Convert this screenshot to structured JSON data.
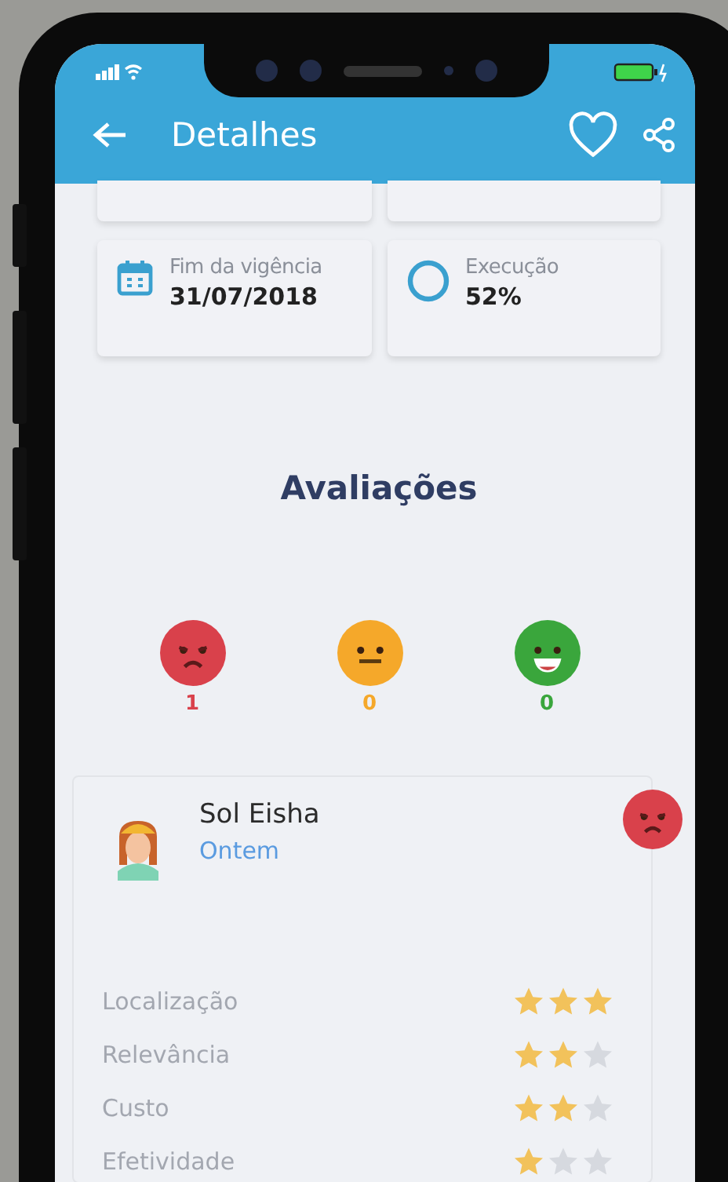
{
  "header": {
    "title": "Detalhes",
    "favorite": false
  },
  "info_cards": [
    {
      "kind": "calendar",
      "label": "Fim da vigência",
      "value": "31/07/2018"
    },
    {
      "kind": "progress",
      "label": "Execução",
      "value": "52%"
    }
  ],
  "section_title": "Avaliações",
  "sentiment_counts": [
    {
      "kind": "negative",
      "count": "1",
      "color": "#d9414b"
    },
    {
      "kind": "neutral",
      "count": "0",
      "color": "#f5a82a"
    },
    {
      "kind": "positive",
      "count": "0",
      "color": "#3aa63c"
    }
  ],
  "review": {
    "author": "Sol Eisha",
    "time": "Ontem",
    "kind": "negative",
    "criteria": [
      {
        "label": "Localização",
        "stars": 3
      },
      {
        "label": "Relevância",
        "stars": 2
      },
      {
        "label": "Custo",
        "stars": 2
      },
      {
        "label": "Efetividade",
        "stars": 1
      }
    ]
  }
}
